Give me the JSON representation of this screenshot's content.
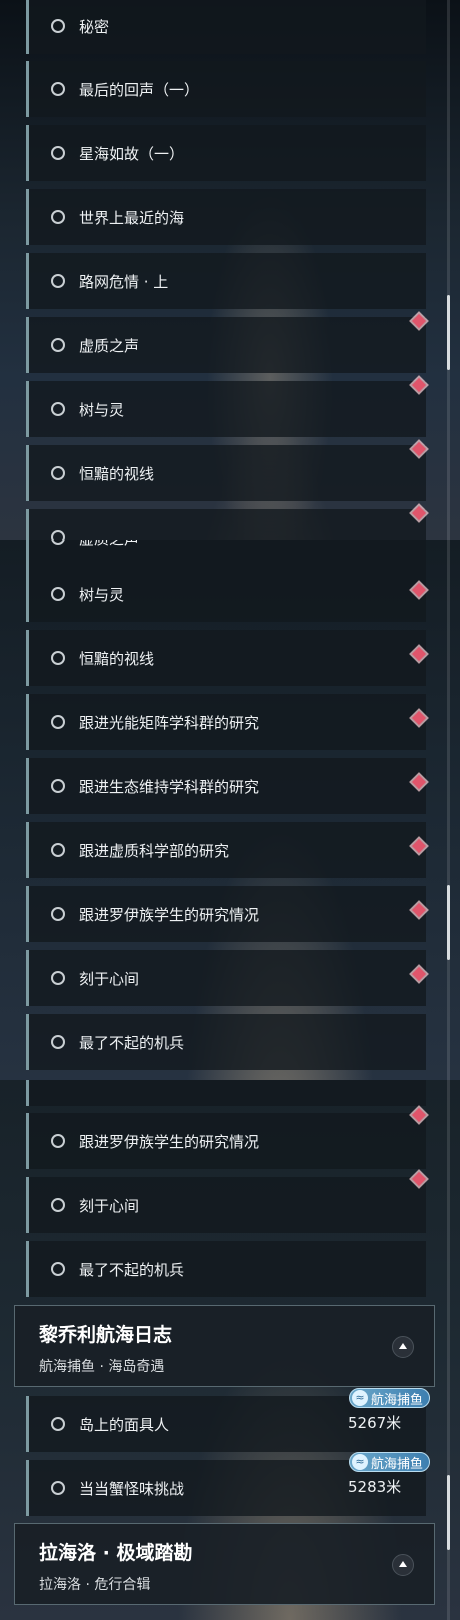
{
  "section1": {
    "items": [
      {
        "label": "秘密",
        "marker": false
      },
      {
        "label": "最后的回声（一）",
        "marker": false
      },
      {
        "label": "星海如故（一）",
        "marker": false
      },
      {
        "label": "世界上最近的海",
        "marker": false
      },
      {
        "label": "路网危情 · 上",
        "marker": false
      },
      {
        "label": "虚质之声",
        "marker": true
      },
      {
        "label": "树与灵",
        "marker": true
      },
      {
        "label": "恒黯的视线",
        "marker": true
      },
      {
        "label": "",
        "marker": true
      }
    ]
  },
  "section2": {
    "items": [
      {
        "label": "虚质之声",
        "marker": false
      },
      {
        "label": "树与灵",
        "marker": true
      },
      {
        "label": "恒黯的视线",
        "marker": true
      },
      {
        "label": "跟进光能矩阵学科群的研究",
        "marker": true
      },
      {
        "label": "跟进生态维持学科群的研究",
        "marker": true
      },
      {
        "label": "跟进虚质科学部的研究",
        "marker": true
      },
      {
        "label": "跟进罗伊族学生的研究情况",
        "marker": true
      },
      {
        "label": "刻于心间",
        "marker": true
      },
      {
        "label": "最了不起的机兵",
        "marker": false
      }
    ]
  },
  "section3": {
    "items": [
      {
        "label": "跟进罗伊族学生的研究情况",
        "marker": true
      },
      {
        "label": "刻于心间",
        "marker": true
      },
      {
        "label": "最了不起的机兵",
        "marker": false
      }
    ],
    "group1": {
      "title": "黎乔利航海日志",
      "subtitle": "航海捕鱼 · 海岛奇遇",
      "items": [
        {
          "label": "岛上的面具人",
          "badge": "航海捕鱼",
          "distance": "5267米"
        },
        {
          "label": "当当蟹怪味挑战",
          "badge": "航海捕鱼",
          "distance": "5283米"
        }
      ]
    },
    "group2": {
      "title": "拉海洛 · 极域踏勘",
      "subtitle": "拉海洛 · 危行合辑"
    }
  },
  "colors": {
    "accent_border": "#7d9aa1",
    "marker": "#e0556b",
    "badge": "#3d7fb0"
  },
  "icons": {
    "status": "circle-outline-icon",
    "marker": "red-diamond-icon",
    "collapse": "chevron-up-icon",
    "badge": "wave-icon"
  }
}
